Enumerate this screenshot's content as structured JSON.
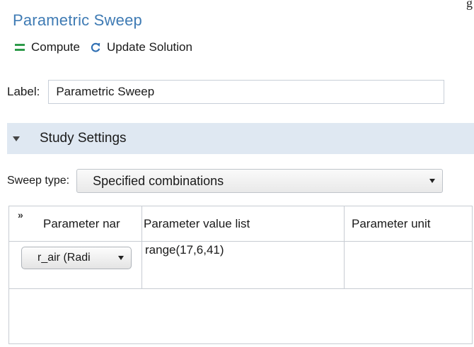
{
  "corner_text": "g",
  "title": "Parametric Sweep",
  "toolbar": {
    "compute_label": "Compute",
    "compute_icon": "equals-icon",
    "update_label": "Update Solution",
    "update_icon": "refresh-icon"
  },
  "label_field": {
    "label": "Label:",
    "value": "Parametric Sweep"
  },
  "section": {
    "title": "Study Settings",
    "expanded": true
  },
  "sweep": {
    "label": "Sweep type:",
    "selected": "Specified combinations"
  },
  "table": {
    "expand_glyph": "»",
    "headers": [
      "Parameter nar",
      "Parameter value list",
      "Parameter unit"
    ],
    "rows": [
      {
        "name": "r_air (Radi",
        "values": "range(17,6,41)",
        "unit": ""
      }
    ]
  },
  "colors": {
    "title": "#3f7bb4",
    "compute_icon": "#2e9b4a",
    "update_icon": "#2f6fb3",
    "section_band": "#dfe8f2"
  }
}
